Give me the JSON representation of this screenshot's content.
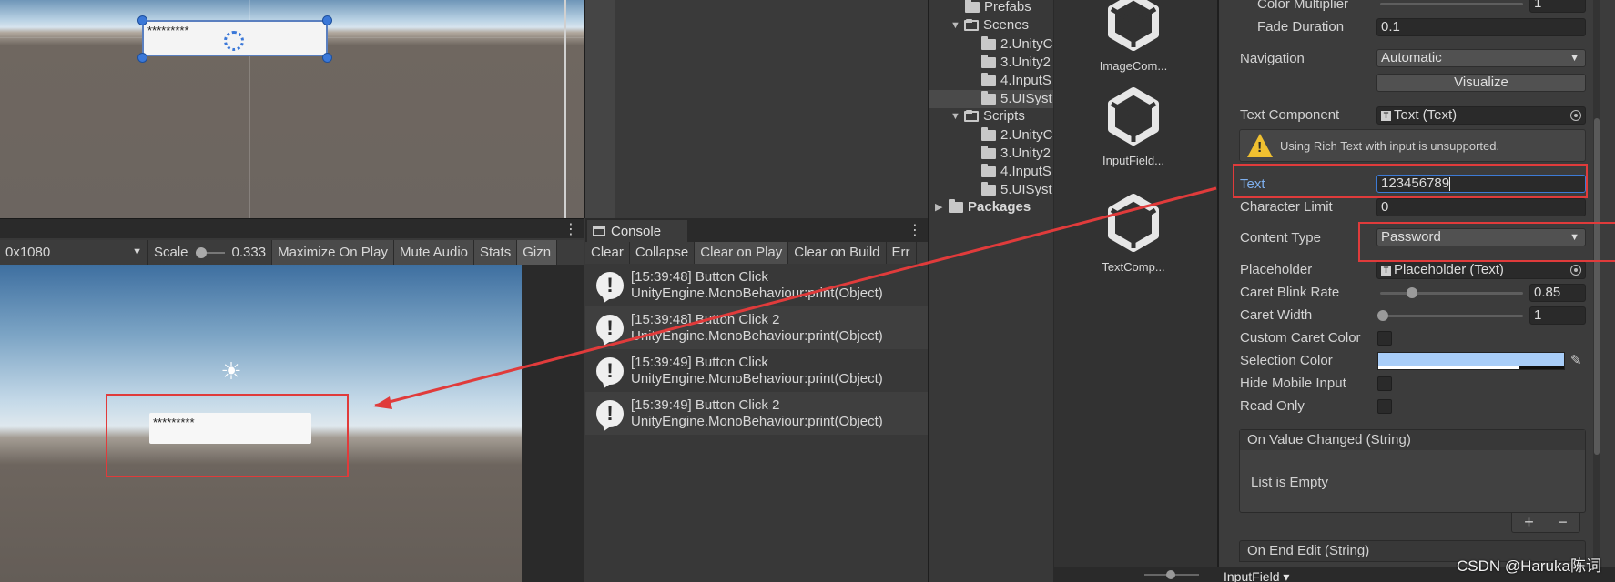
{
  "scene": {
    "input_mask": "*********"
  },
  "game": {
    "resolution": "0x1080",
    "scale_label": "Scale",
    "scale_value": "0.333",
    "buttons": [
      "Maximize On Play",
      "Mute Audio",
      "Stats",
      "Gizn"
    ],
    "input_mask": "*********"
  },
  "console": {
    "tab_label": "Console",
    "menu_icon": "⋮",
    "toolbar": [
      "Clear",
      "Collapse",
      "Clear on Play",
      "Clear on Build",
      "Err"
    ],
    "active_toolbar": "Clear on Play",
    "logs": [
      {
        "line1": "[15:39:48] Button Click",
        "line2": "UnityEngine.MonoBehaviour:print(Object)"
      },
      {
        "line1": "[15:39:48] Button Click 2",
        "line2": "UnityEngine.MonoBehaviour:print(Object)"
      },
      {
        "line1": "[15:39:49] Button Click",
        "line2": "UnityEngine.MonoBehaviour:print(Object)"
      },
      {
        "line1": "[15:39:49] Button Click 2",
        "line2": "UnityEngine.MonoBehaviour:print(Object)"
      }
    ]
  },
  "project": {
    "tree": [
      {
        "label": "Prefabs"
      },
      {
        "label": "Scenes"
      },
      {
        "label": "2.UnityC"
      },
      {
        "label": "3.Unity2"
      },
      {
        "label": "4.InputS"
      },
      {
        "label": "5.UISyst"
      },
      {
        "label": "Scripts"
      },
      {
        "label": "2.UnityC"
      },
      {
        "label": "3.Unity2"
      },
      {
        "label": "4.InputS"
      },
      {
        "label": "5.UISyst"
      },
      {
        "label": "Packages"
      }
    ],
    "assets": [
      "ImageCom...",
      "InputField...",
      "TextComp..."
    ]
  },
  "inspector": {
    "color_multiplier_label": "Color Multiplier",
    "color_multiplier_value": "1",
    "fade_duration_label": "Fade Duration",
    "fade_duration_value": "0.1",
    "navigation_label": "Navigation",
    "navigation_value": "Automatic",
    "visualize_label": "Visualize",
    "text_component_label": "Text Component",
    "text_component_value": "Text (Text)",
    "warning_text": "Using Rich Text with input is unsupported.",
    "text_label": "Text",
    "text_value": "123456789",
    "character_limit_label": "Character Limit",
    "character_limit_value": "0",
    "content_type_label": "Content Type",
    "content_type_value": "Password",
    "placeholder_label": "Placeholder",
    "placeholder_value": "Placeholder (Text)",
    "caret_blink_label": "Caret Blink Rate",
    "caret_blink_value": "0.85",
    "caret_width_label": "Caret Width",
    "caret_width_value": "1",
    "custom_caret_label": "Custom Caret Color",
    "selection_color_label": "Selection Color",
    "selection_color": "#a8cdf8",
    "hide_mobile_label": "Hide Mobile Input",
    "read_only_label": "Read Only",
    "on_value_changed_label": "On Value Changed (String)",
    "list_empty_label": "List is Empty",
    "plus_label": "+",
    "minus_label": "−",
    "on_end_edit_label": "On End Edit (String)",
    "bottom_tab_label": "InputField ▾"
  },
  "watermark": "CSDN @Haruka陈词",
  "colors": {
    "annotation_red": "#e03b3b",
    "warning_yellow": "#f0c030",
    "accent_blue": "#3b78d8"
  }
}
